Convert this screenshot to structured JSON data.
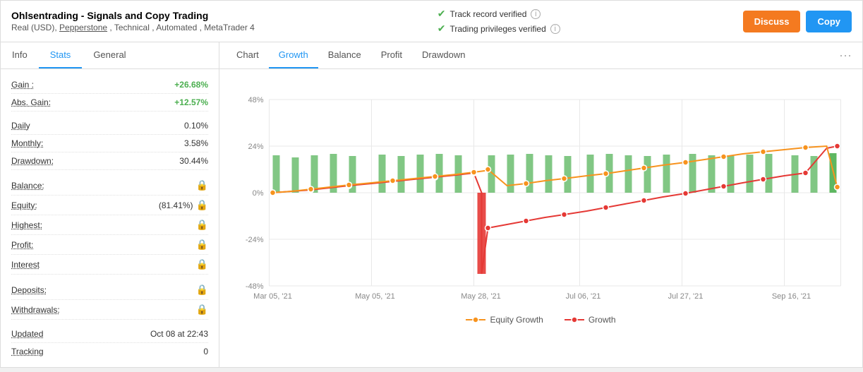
{
  "header": {
    "title": "Ohlsentrading - Signals and Copy Trading",
    "subtitle": "Real (USD), Pepperstone , Technical , Automated , MetaTrader 4",
    "verify1": "Track record verified",
    "verify2": "Trading privileges verified",
    "btn_discuss": "Discuss",
    "btn_copy": "Copy"
  },
  "left_tabs": [
    {
      "label": "Info",
      "active": false
    },
    {
      "label": "Stats",
      "active": true
    },
    {
      "label": "General",
      "active": false
    }
  ],
  "stats": {
    "gain_label": "Gain :",
    "gain_value": "+26.68%",
    "abs_gain_label": "Abs. Gain:",
    "abs_gain_value": "+12.57%",
    "daily_label": "Daily",
    "daily_value": "0.10%",
    "monthly_label": "Monthly:",
    "monthly_value": "3.58%",
    "drawdown_label": "Drawdown:",
    "drawdown_value": "30.44%",
    "balance_label": "Balance:",
    "equity_label": "Equity:",
    "equity_value": "(81.41%)",
    "highest_label": "Highest:",
    "profit_label": "Profit:",
    "interest_label": "Interest",
    "deposits_label": "Deposits:",
    "withdrawals_label": "Withdrawals:",
    "updated_label": "Updated",
    "updated_value": "Oct 08 at 22:43",
    "tracking_label": "Tracking",
    "tracking_value": "0"
  },
  "chart_tabs": [
    {
      "label": "Chart",
      "active": false
    },
    {
      "label": "Growth",
      "active": true
    },
    {
      "label": "Balance",
      "active": false
    },
    {
      "label": "Profit",
      "active": false
    },
    {
      "label": "Drawdown",
      "active": false
    }
  ],
  "chart": {
    "y_labels": [
      "48%",
      "24%",
      "0%",
      "-24%",
      "-48%"
    ],
    "x_labels": [
      "Mar 05, '21",
      "May 05, '21",
      "May 28, '21",
      "Jul 06, '21",
      "Jul 27, '21",
      "Sep 16, '21"
    ],
    "legend": [
      {
        "label": "Equity Growth",
        "color": "#f7931e",
        "dot_color": "#fff"
      },
      {
        "label": "Growth",
        "color": "#e53935",
        "dot_color": "#fff"
      }
    ]
  }
}
